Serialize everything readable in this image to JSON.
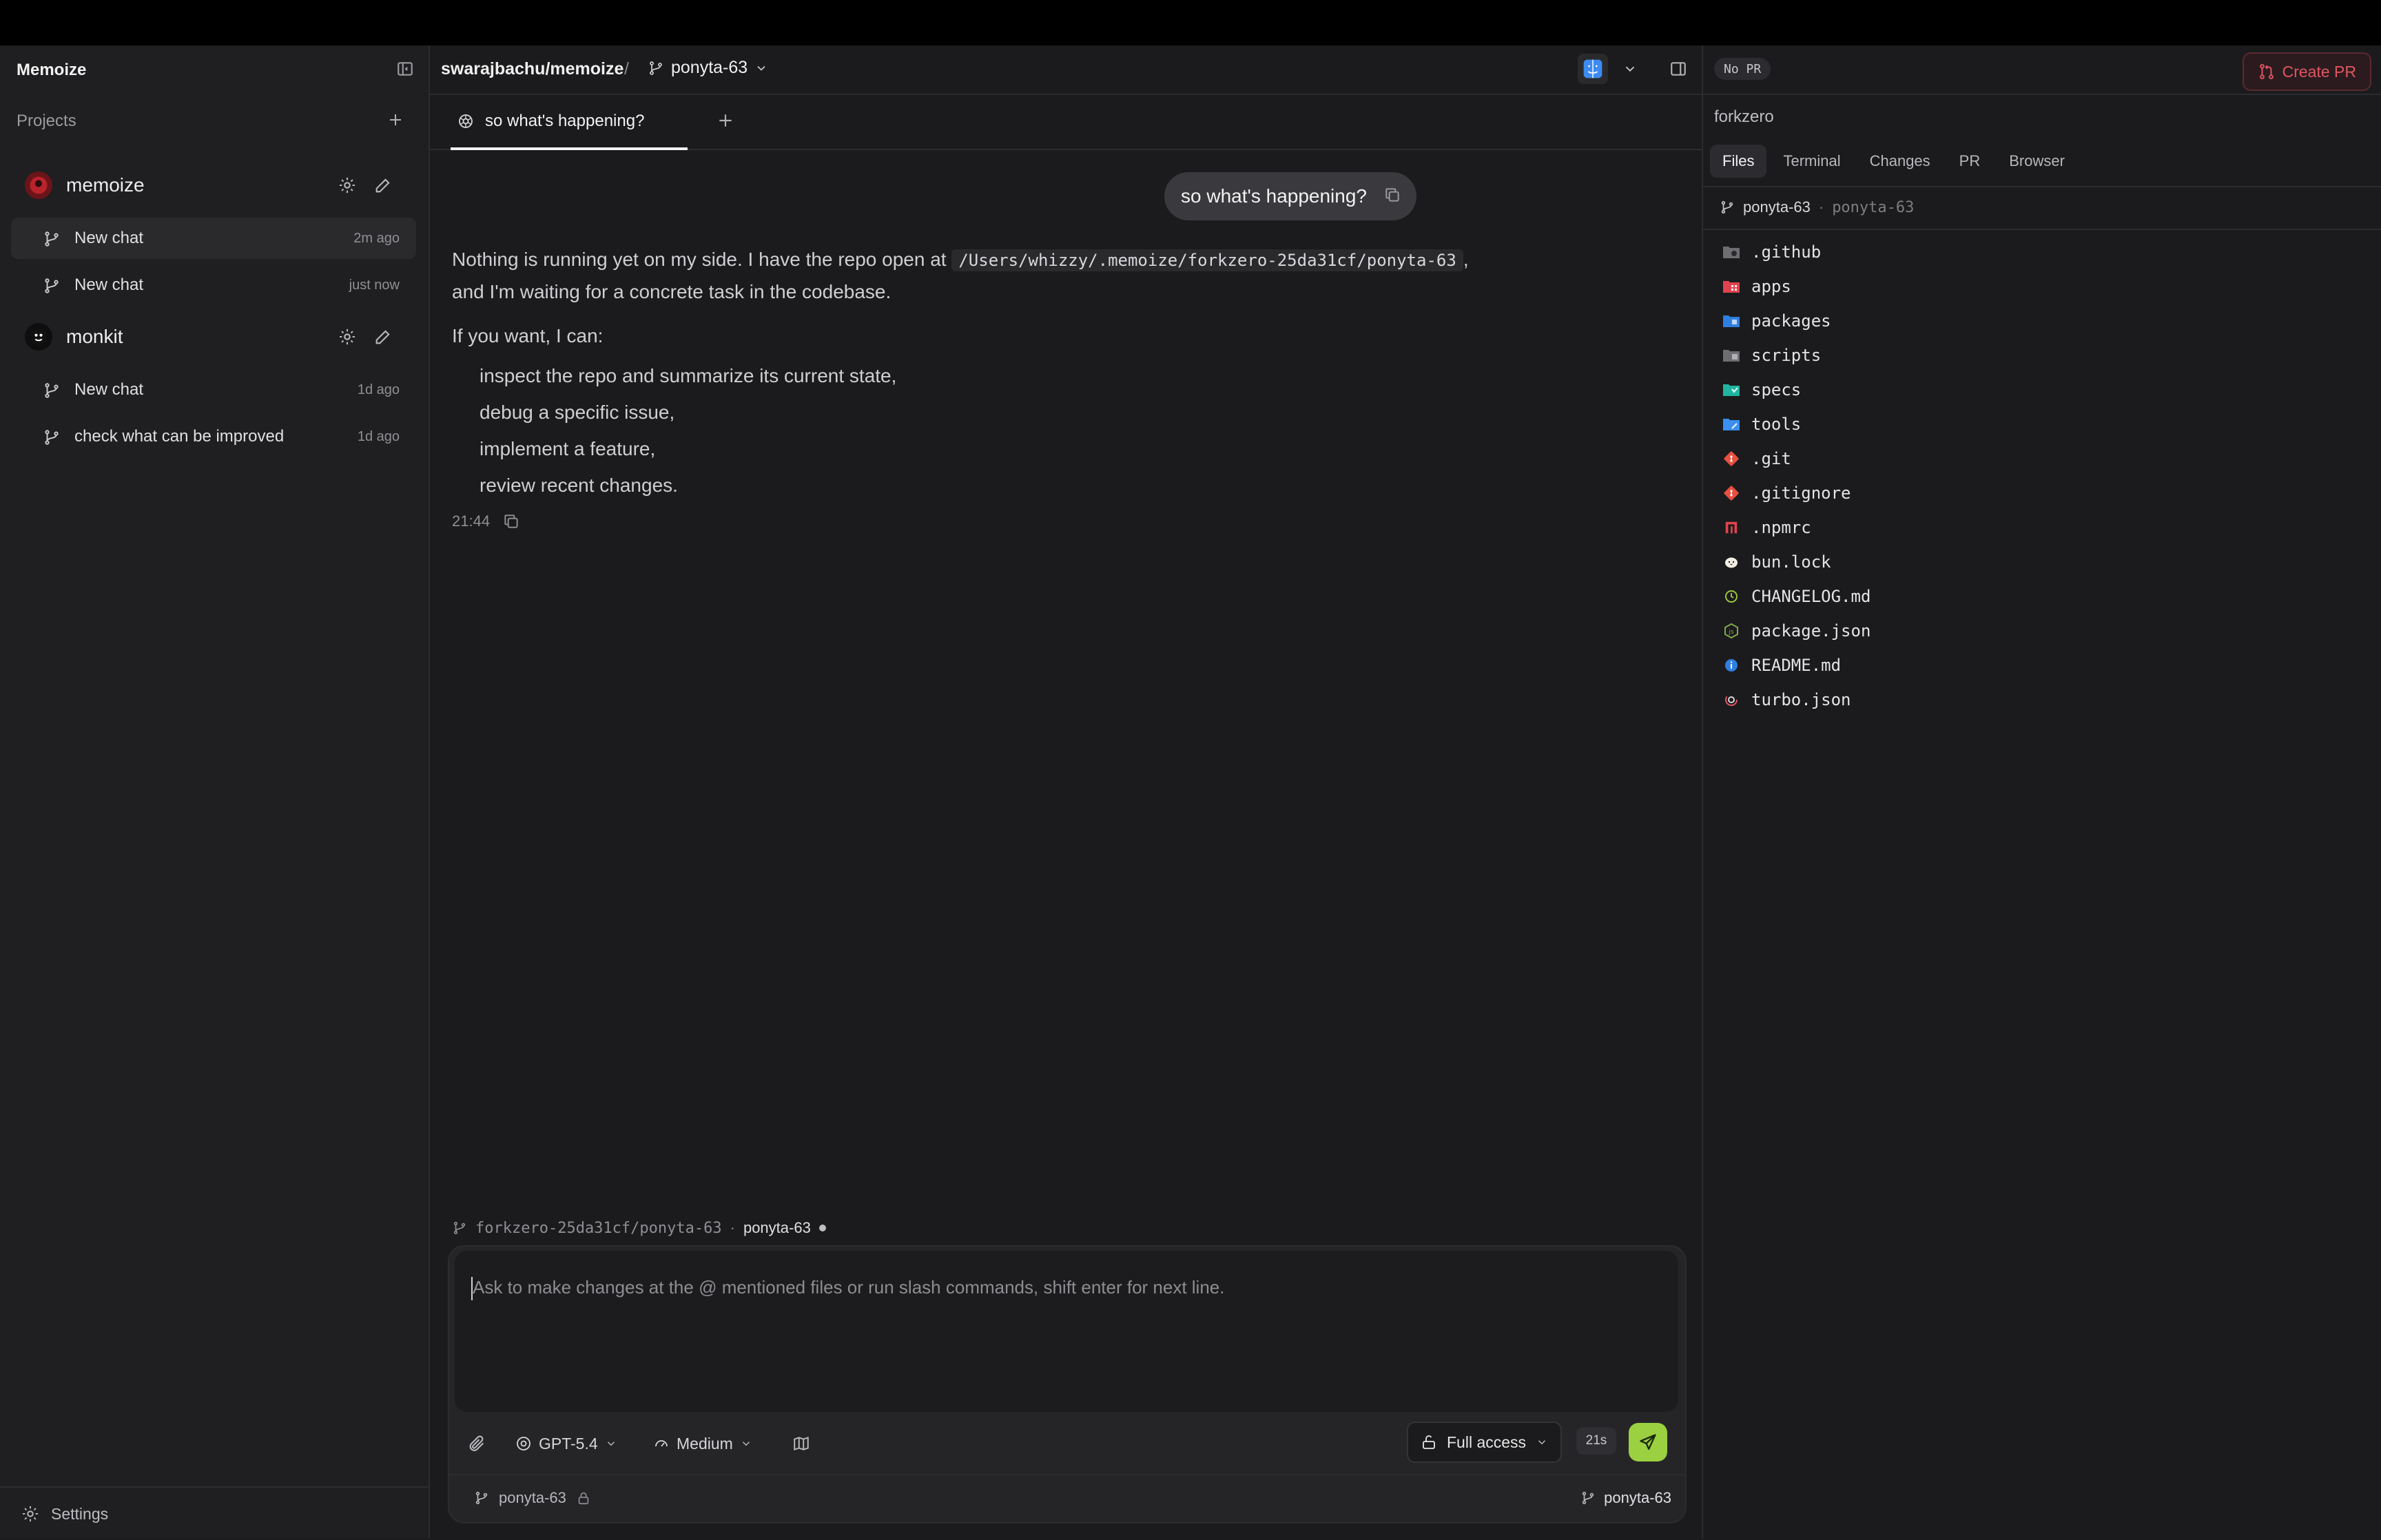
{
  "sidebar": {
    "app_title": "Memoize",
    "projects_label": "Projects",
    "projects": [
      {
        "name": "memoize",
        "chats": [
          {
            "label": "New chat",
            "time": "2m ago",
            "active": true
          },
          {
            "label": "New chat",
            "time": "just now",
            "active": false
          }
        ]
      },
      {
        "name": "monkit",
        "chats": [
          {
            "label": "New chat",
            "time": "1d ago",
            "active": false
          },
          {
            "label": "check what can be improved",
            "time": "1d ago",
            "active": false
          }
        ]
      }
    ],
    "settings_label": "Settings"
  },
  "header": {
    "repo": "swarajbachu/memoize",
    "separator": "/",
    "branch": "ponyta-63"
  },
  "tabs": [
    {
      "label": "so what's happening?",
      "active": true
    }
  ],
  "conversation": {
    "user_message": "so what's happening?",
    "assistant": {
      "line1_pre": "Nothing is running yet on my side. I have the repo open at",
      "path": "/Users/whizzy/.memoize/forkzero-25da31cf/ponyta-63",
      "line1_post": ",",
      "line2": "and I'm waiting for a concrete task in the codebase.",
      "line3": "If you want, I can:",
      "items": [
        "inspect the repo and summarize its current state,",
        "debug a specific issue,",
        "implement a feature,",
        "review recent changes."
      ],
      "timestamp": "21:44"
    }
  },
  "composer": {
    "path": "forkzero-25da31cf/ponyta-63",
    "path_sep": "·",
    "branch": "ponyta-63",
    "placeholder": "Ask to make changes at the @ mentioned files or run slash commands, shift enter for next line.",
    "model": "GPT-5.4",
    "effort": "Medium",
    "access": "Full access",
    "timer": "21s",
    "footer_left_branch": "ponyta-63",
    "footer_right_branch": "ponyta-63"
  },
  "right_panel": {
    "pr_status": "No PR",
    "create_pr_label": "Create PR",
    "workspace": "forkzero",
    "tabs": [
      "Files",
      "Terminal",
      "Changes",
      "PR",
      "Browser"
    ],
    "active_tab": "Files",
    "branch": "ponyta-63",
    "branch_sep": "·",
    "branch_dim": "ponyta-63",
    "files": [
      {
        "name": ".github",
        "icon": "folder-github-icon"
      },
      {
        "name": "apps",
        "icon": "folder-apps-icon"
      },
      {
        "name": "packages",
        "icon": "folder-packages-icon"
      },
      {
        "name": "scripts",
        "icon": "folder-scripts-icon"
      },
      {
        "name": "specs",
        "icon": "folder-specs-icon"
      },
      {
        "name": "tools",
        "icon": "folder-tools-icon"
      },
      {
        "name": ".git",
        "icon": "git-icon"
      },
      {
        "name": ".gitignore",
        "icon": "git-icon"
      },
      {
        "name": ".npmrc",
        "icon": "npm-icon"
      },
      {
        "name": "bun.lock",
        "icon": "bun-icon"
      },
      {
        "name": "CHANGELOG.md",
        "icon": "changelog-icon"
      },
      {
        "name": "package.json",
        "icon": "nodejs-icon"
      },
      {
        "name": "README.md",
        "icon": "info-icon"
      },
      {
        "name": "turbo.json",
        "icon": "turbo-icon"
      }
    ]
  },
  "colors": {
    "accent_send": "#9bd041",
    "create_pr": "#e05661"
  }
}
